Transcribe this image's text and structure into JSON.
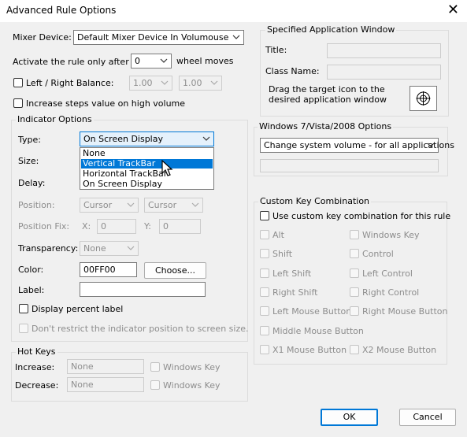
{
  "window": {
    "title": "Advanced Rule Options",
    "close_glyph": "✕"
  },
  "mixer": {
    "label": "Mixer Device:",
    "value": "Default Mixer Device In Volumouse"
  },
  "activate": {
    "label": "Activate the rule only after",
    "value": "0",
    "suffix": "wheel moves"
  },
  "balance": {
    "label": "Left / Right Balance:",
    "left": "1.00",
    "right": "1.00"
  },
  "increase_steps_label": "Increase steps value on high volume",
  "indicator": {
    "title": "Indicator Options",
    "type_label": "Type:",
    "type_value": "On Screen Display",
    "type_options": [
      "None",
      "Vertical TrackBar",
      "Horizontal TrackBar",
      "On Screen Display"
    ],
    "size_label": "Size:",
    "delay_label": "Delay:",
    "position_label": "Position:",
    "position_x": "Cursor",
    "position_y": "Cursor",
    "position_fix_label": "Position Fix:",
    "x_label": "X:",
    "x_value": "0",
    "y_label": "Y:",
    "y_value": "0",
    "transparency_label": "Transparency:",
    "transparency_value": "None",
    "color_label": "Color:",
    "color_value": "00FF00",
    "choose_label": "Choose...",
    "label_label": "Label:",
    "label_value": "",
    "display_percent_label": "Display percent label",
    "dont_restrict_label": "Don't restrict the indicator position to screen size."
  },
  "hotkeys": {
    "title": "Hot Keys",
    "increase_label": "Increase:",
    "increase_value": "None",
    "decrease_label": "Decrease:",
    "decrease_value": "None",
    "windows_key_label": "Windows Key"
  },
  "app_window": {
    "title": "Specified Application Window",
    "title_label": "Title:",
    "class_label": "Class Name:",
    "drag_text": "Drag the target icon to the desired application window"
  },
  "win7": {
    "title": "Windows 7/Vista/2008 Options",
    "value": "Change system volume - for all applications"
  },
  "custom_keys": {
    "title": "Custom Key Combination",
    "use_label": "Use custom key combination for this rule",
    "left": [
      "Alt",
      "Shift",
      "Left Shift",
      "Right Shift",
      "Left Mouse Button",
      "Middle Mouse Button",
      "X1 Mouse Button"
    ],
    "right": [
      "Windows Key",
      "Control",
      "Left Control",
      "Right Control",
      "Right Mouse Button",
      "X2 Mouse Button"
    ]
  },
  "buttons": {
    "ok": "OK",
    "cancel": "Cancel"
  }
}
